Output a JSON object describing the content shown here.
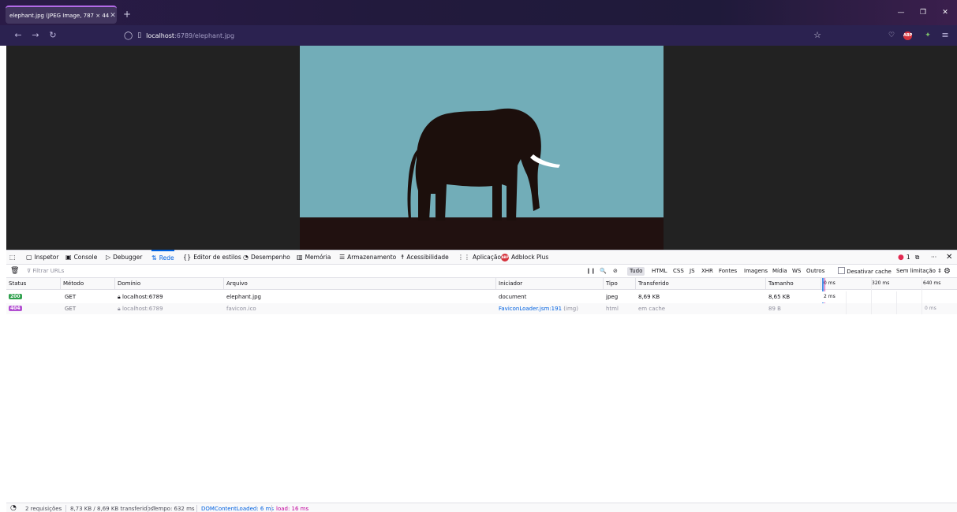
{
  "browser": {
    "tab_title": "elephant.jpg (JPEG Image, 787 × 44",
    "new_tab_icon": "plus-icon",
    "url_host": "localhost",
    "url_path": ":6789/elephant.jpg",
    "abp_label": "ABP"
  },
  "devtools": {
    "tabs": [
      {
        "label": "Inspetor",
        "icon": "inspector-icon"
      },
      {
        "label": "Console",
        "icon": "console-icon"
      },
      {
        "label": "Debugger",
        "icon": "debugger-icon"
      },
      {
        "label": "Rede",
        "icon": "network-icon"
      },
      {
        "label": "Editor de estilos",
        "icon": "braces-icon"
      },
      {
        "label": "Desempenho",
        "icon": "performance-icon"
      },
      {
        "label": "Memória",
        "icon": "memory-icon"
      },
      {
        "label": "Armazenamento",
        "icon": "storage-icon"
      },
      {
        "label": "Acessibilidade",
        "icon": "accessibility-icon"
      },
      {
        "label": "Aplicação",
        "icon": "application-icon"
      },
      {
        "label": "Adblock Plus",
        "icon": "abp-icon"
      }
    ],
    "error_count": "1",
    "filter_placeholder": "Filtrar URLs",
    "type_filters": [
      "Tudo",
      "HTML",
      "CSS",
      "JS",
      "XHR",
      "Fontes",
      "Imagens",
      "Mídia",
      "WS",
      "Outros"
    ],
    "disable_cache": "Desativar cache",
    "throttle": "Sem limitação ⇕",
    "columns": [
      "Status",
      "Método",
      "Domínio",
      "Arquivo",
      "Iniciador",
      "Tipo",
      "Transferido",
      "Tamanho"
    ],
    "timeline_ticks": [
      "0 ms",
      "320 ms",
      "640 ms"
    ],
    "rows": [
      {
        "status": "200",
        "method": "GET",
        "domain": "localhost:6789",
        "file": "elephant.jpg",
        "initiator": "document",
        "initiator_extra": "",
        "type": "jpeg",
        "transferred": "8,69 KB",
        "size": "8,65 KB",
        "timing": "2 ms"
      },
      {
        "status": "404",
        "method": "GET",
        "domain": "localhost:6789",
        "file": "favicon.ico",
        "initiator": "FaviconLoader.jsm:191",
        "initiator_extra": "(img)",
        "type": "html",
        "transferred": "em cache",
        "size": "89 B",
        "timing": "0 ms"
      }
    ],
    "status_bar": {
      "requests": "2 requisições",
      "transferred": "8,73 KB / 8,69 KB transferidos",
      "time": "Tempo: 632 ms",
      "dom": "DOMContentLoaded: 6 ms",
      "load": "load: 16 ms"
    },
    "colors": {
      "ok": "#30a14e",
      "notfound": "#b24fd1",
      "accent": "#0061e0",
      "dom": "#0061e0",
      "load": "#c1009b"
    }
  }
}
